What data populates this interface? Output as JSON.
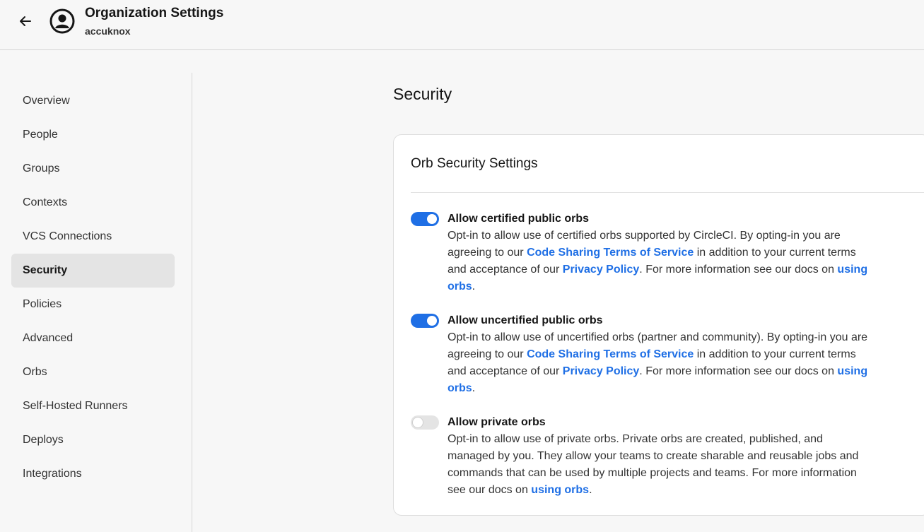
{
  "header": {
    "title": "Organization Settings",
    "subtitle": "accuknox",
    "back_icon": "arrow-left-icon",
    "avatar_icon": "user-circle-icon"
  },
  "sidebar": {
    "items": [
      {
        "label": "Overview"
      },
      {
        "label": "People"
      },
      {
        "label": "Groups"
      },
      {
        "label": "Contexts"
      },
      {
        "label": "VCS Connections"
      },
      {
        "label": "Security",
        "active": true
      },
      {
        "label": "Policies"
      },
      {
        "label": "Advanced"
      },
      {
        "label": "Orbs"
      },
      {
        "label": "Self-Hosted Runners"
      },
      {
        "label": "Deploys"
      },
      {
        "label": "Integrations"
      }
    ]
  },
  "main": {
    "title": "Security",
    "card": {
      "title": "Orb Security Settings",
      "settings": [
        {
          "label": "Allow certified public orbs",
          "enabled": true,
          "desc_1": "Opt-in to allow use of certified orbs supported by CircleCI. By opting-in you are agreeing to our ",
          "link_1": "Code Sharing Terms of Service",
          "desc_2": " in addition to your current terms and acceptance of our ",
          "link_2": "Privacy Policy",
          "desc_3": ". For more information see our docs on ",
          "link_3": "using orbs",
          "desc_4": "."
        },
        {
          "label": "Allow uncertified public orbs",
          "enabled": true,
          "desc_1": "Opt-in to allow use of uncertified orbs (partner and community). By opting-in you are agreeing to our ",
          "link_1": "Code Sharing Terms of Service",
          "desc_2": " in addition to your current terms and acceptance of our ",
          "link_2": "Privacy Policy",
          "desc_3": ". For more information see our docs on ",
          "link_3": "using orbs",
          "desc_4": "."
        },
        {
          "label": "Allow private orbs",
          "enabled": false,
          "desc_1": "Opt-in to allow use of private orbs. Private orbs are created, published, and managed by you. They allow your teams to create sharable and reusable jobs and commands that can be used by multiple projects and teams. For more information see our docs on ",
          "link_1": "using orbs",
          "desc_2": "."
        }
      ]
    }
  },
  "colors": {
    "accent": "#1f6fe5",
    "background": "#f7f7f7",
    "card": "#ffffff",
    "active_nav": "#e4e4e4"
  }
}
